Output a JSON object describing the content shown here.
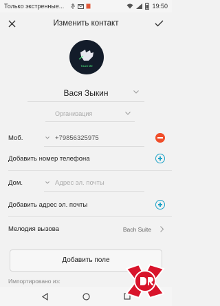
{
  "status_bar": {
    "carrier": "Только экстренные...",
    "time": "19:50",
    "icons": [
      "usb-icon",
      "mail-icon",
      "sim-icon",
      "wifi-icon",
      "signal-icon",
      "battery-icon"
    ]
  },
  "app_bar": {
    "title": "Изменить контакт",
    "close_icon": "close-icon",
    "confirm_icon": "check-icon"
  },
  "avatar": {
    "caption": "Touch Me"
  },
  "contact": {
    "name": "Вася Зыкин",
    "organization_placeholder": "Организация"
  },
  "phone": {
    "type_label": "Моб.",
    "number": "+79856325975"
  },
  "add_phone": {
    "label": "Добавить номер телефона"
  },
  "email": {
    "type_label": "Дом.",
    "placeholder": "Адрес эл. почты"
  },
  "add_email": {
    "label": "Добавить адрес эл. почты"
  },
  "ringtone": {
    "label": "Мелодия вызова",
    "value": "Bach Suite"
  },
  "add_field": {
    "label": "Добавить поле"
  },
  "imported": {
    "label": "Импортировано из:"
  },
  "colors": {
    "accent": "#1ea3c8",
    "remove": "#f04e2a",
    "background": "#f2f2f2"
  }
}
